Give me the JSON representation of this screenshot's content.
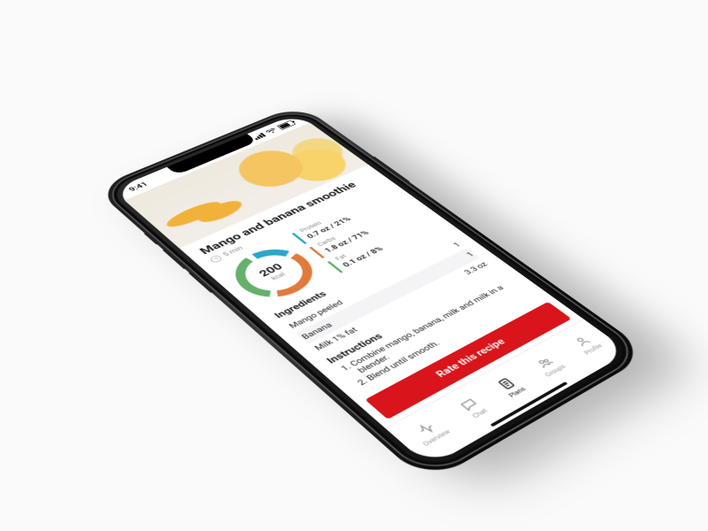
{
  "status": {
    "time": "9:41"
  },
  "recipe": {
    "title": "Mango and banana smoothie",
    "prep_time": "5 min",
    "calories": {
      "value": "200",
      "unit": "kcal"
    },
    "macros": {
      "protein": {
        "label": "Protein",
        "value": "0.7 oz / 21%"
      },
      "carbs": {
        "label": "Carbs",
        "value": "1.8 oz / 71%"
      },
      "fat": {
        "label": "Fat",
        "value": "0.1 oz / 8%"
      }
    },
    "sections": {
      "ingredients": "Ingredients",
      "instructions": "Instructions"
    },
    "ingredients": [
      {
        "name": "Mango peeled",
        "amount": "1"
      },
      {
        "name": "Banana",
        "amount": "1"
      },
      {
        "name": "Milk 1% fat",
        "amount": "3.3 oz"
      }
    ],
    "instructions": [
      "Combine mango, banana, milk and milk in a blender.",
      "Blend until smooth."
    ],
    "cta": "Rate this recipe"
  },
  "tabs": {
    "overview": "Overview",
    "chat": "Chat",
    "plans": "Plans",
    "groups": "Groups",
    "profile": "Profile"
  }
}
